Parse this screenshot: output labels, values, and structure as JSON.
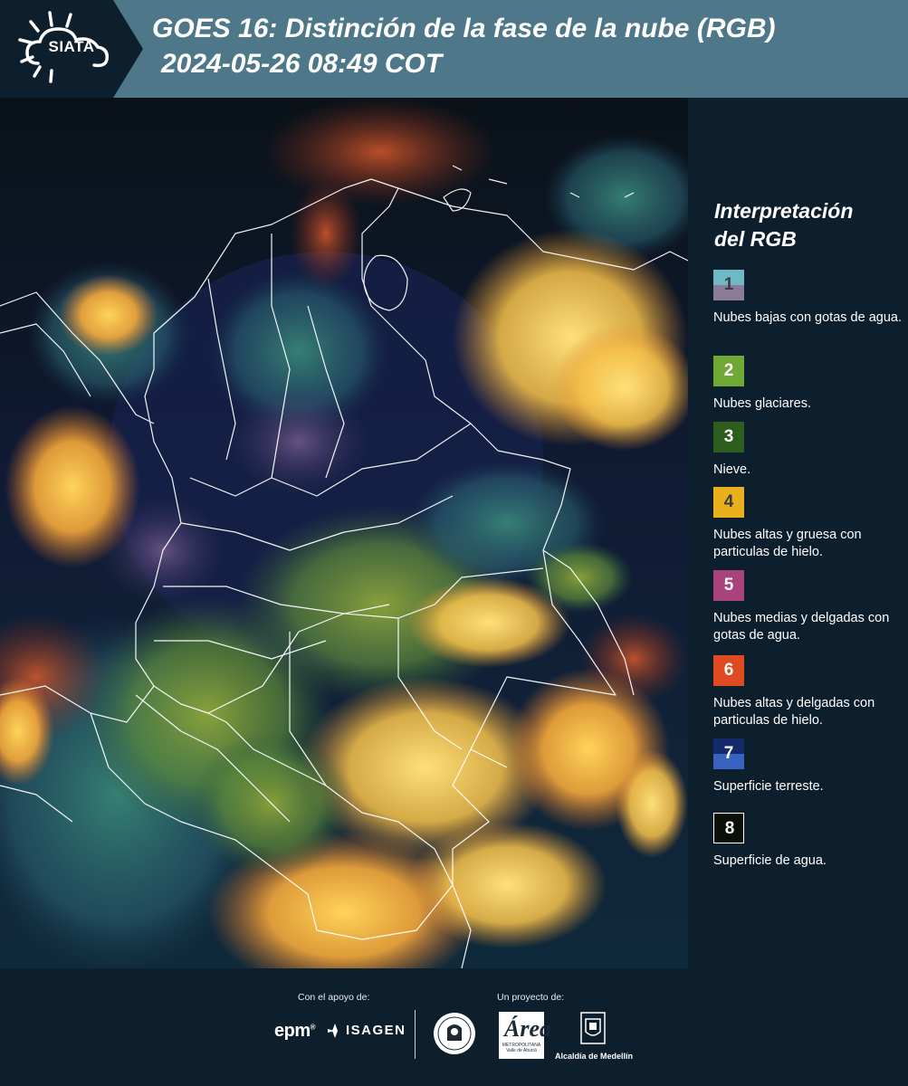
{
  "header": {
    "logo_text": "SIATA",
    "title_line1": "GOES 16: Distinción de la fase de la nube (RGB)",
    "title_line2": "2024-05-26 08:49 COT"
  },
  "legend": {
    "title_line1": "Interpretación",
    "title_line2": "del RGB",
    "items": [
      {
        "number": "1",
        "label": "Nubes bajas con gotas de agua.",
        "color_top": "#6fb8c6",
        "color_bottom": "#8a7c98",
        "num_color": "#3a3a46"
      },
      {
        "number": "2",
        "label": "Nubes glaciares.",
        "color_top": "#6fa832",
        "color_bottom": "#6fa832",
        "num_color": "#ffffff"
      },
      {
        "number": "3",
        "label": "Nieve.",
        "color_top": "#2e5e1e",
        "color_bottom": "#2e5e1e",
        "num_color": "#ffffff"
      },
      {
        "number": "4",
        "label": "Nubes altas y gruesa con particulas de hielo.",
        "color_top": "#e8b01c",
        "color_bottom": "#e8b01c",
        "num_color": "#3a3a3a"
      },
      {
        "number": "5",
        "label": "Nubes medias y delgadas con gotas de agua.",
        "color_top": "#a8437e",
        "color_bottom": "#a8437e",
        "num_color": "#ffffff"
      },
      {
        "number": "6",
        "label": "Nubes altas y delgadas con particulas de hielo.",
        "color_top": "#e04a22",
        "color_bottom": "#e04a22",
        "num_color": "#ffffff"
      },
      {
        "number": "7",
        "label": "Superficie terreste.",
        "color_top": "#142a6a",
        "color_bottom": "#3a62c0",
        "num_color": "#ffffff"
      },
      {
        "number": "8",
        "label": "Superficie de agua.",
        "color_top": "#0a0f0a",
        "color_bottom": "#0a0f0a",
        "num_color": "#ffffff",
        "border": "#ffffff"
      }
    ]
  },
  "footer": {
    "support_label": "Con el apoyo de:",
    "project_label": "Un proyecto de:",
    "epm_text": "epm",
    "epm_mark": "®",
    "isagen_text": "ISAGEN",
    "area_main": "Área",
    "area_sub": "METROPOLITANA Valle de Aburrá",
    "alcaldia_text": "Alcaldía de Medellín"
  },
  "colors": {
    "header_bg": "#4e7889",
    "page_bg": "#0d1e2c",
    "logo_bg": "#0d1e2c"
  }
}
